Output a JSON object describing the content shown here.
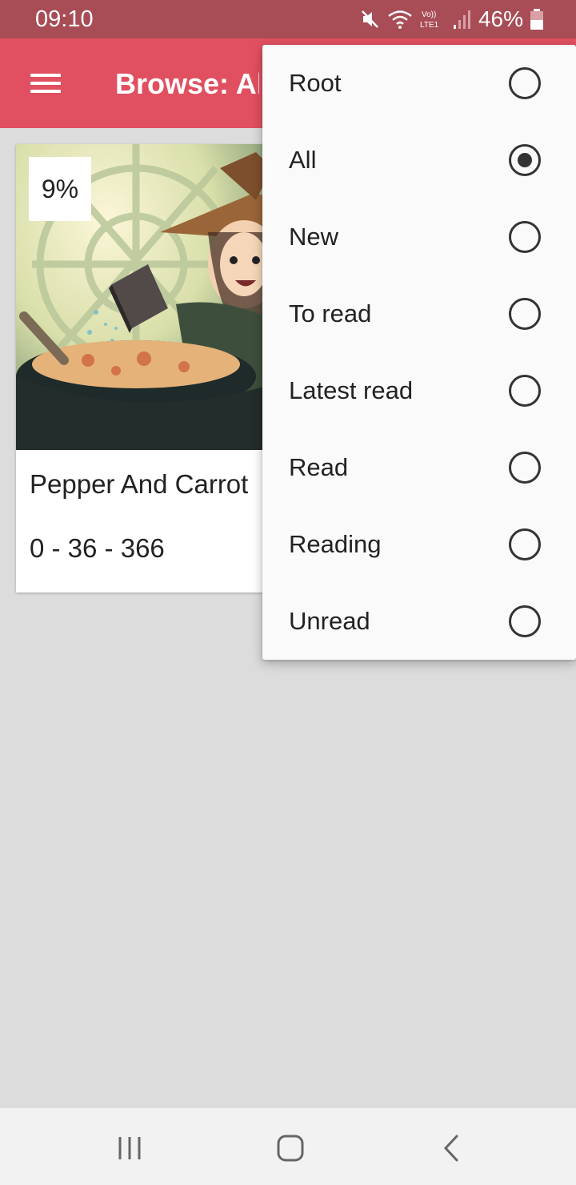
{
  "status_bar": {
    "time": "09:10",
    "battery": "46%",
    "icons": [
      "mute-icon",
      "wifi-icon",
      "volte-lte-icon",
      "signal-icon",
      "battery-icon"
    ]
  },
  "app_bar": {
    "title": "Browse: All",
    "menu_icon": "hamburger-menu-icon",
    "color": "#e05060"
  },
  "card": {
    "progress": "9%",
    "title": "Pepper And Carrot",
    "stats": "0 - 36 - 366"
  },
  "dropdown": {
    "selected": "All",
    "items": [
      {
        "label": "Root",
        "checked": false
      },
      {
        "label": "All",
        "checked": true
      },
      {
        "label": "New",
        "checked": false
      },
      {
        "label": "To read",
        "checked": false
      },
      {
        "label": "Latest read",
        "checked": false
      },
      {
        "label": "Read",
        "checked": false
      },
      {
        "label": "Reading",
        "checked": false
      },
      {
        "label": "Unread",
        "checked": false
      }
    ]
  },
  "nav_bar": {
    "icons": [
      "recents-icon",
      "home-icon",
      "back-icon"
    ]
  }
}
